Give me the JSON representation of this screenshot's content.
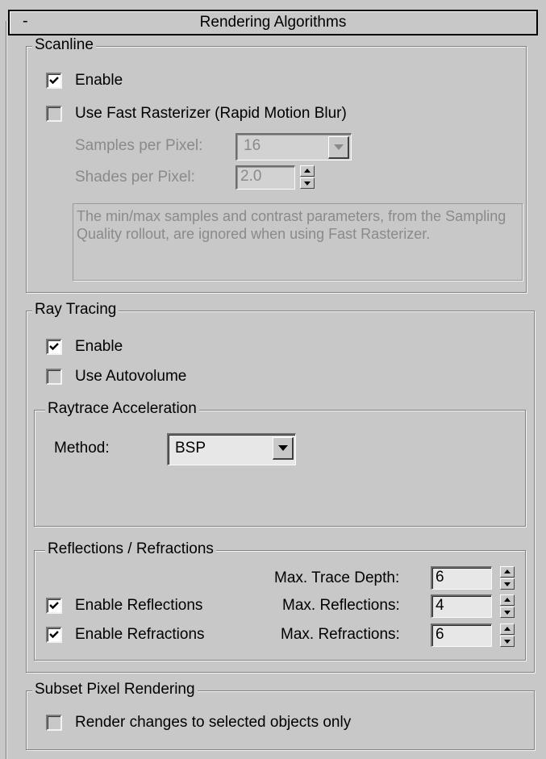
{
  "rollout": {
    "toggle": "-",
    "title": "Rendering Algorithms"
  },
  "scanline": {
    "legend": "Scanline",
    "enable_label": "Enable",
    "enable_checked": true,
    "fast_rasterizer_label": "Use Fast Rasterizer (Rapid Motion Blur)",
    "fast_rasterizer_checked": false,
    "samples_label": "Samples per Pixel:",
    "samples_value": "16",
    "shades_label": "Shades per Pixel:",
    "shades_value": "2.0",
    "info_text": "The min/max samples and contrast parameters, from the Sampling Quality rollout, are ignored when using Fast Rasterizer."
  },
  "raytracing": {
    "legend": "Ray Tracing",
    "enable_label": "Enable",
    "enable_checked": true,
    "autovolume_label": "Use Autovolume",
    "autovolume_checked": false,
    "accel": {
      "legend": "Raytrace Acceleration",
      "method_label": "Method:",
      "method_value": "BSP"
    },
    "reflref": {
      "legend": "Reflections / Refractions",
      "trace_depth_label": "Max. Trace Depth:",
      "trace_depth_value": "6",
      "reflections_enable_label": "Enable Reflections",
      "reflections_checked": true,
      "reflections_max_label": "Max. Reflections:",
      "reflections_max_value": "4",
      "refractions_enable_label": "Enable Refractions",
      "refractions_checked": true,
      "refractions_max_label": "Max. Refractions:",
      "refractions_max_value": "6"
    }
  },
  "subset": {
    "legend": "Subset Pixel Rendering",
    "render_changes_label": "Render changes to selected objects only",
    "render_changes_checked": false
  }
}
